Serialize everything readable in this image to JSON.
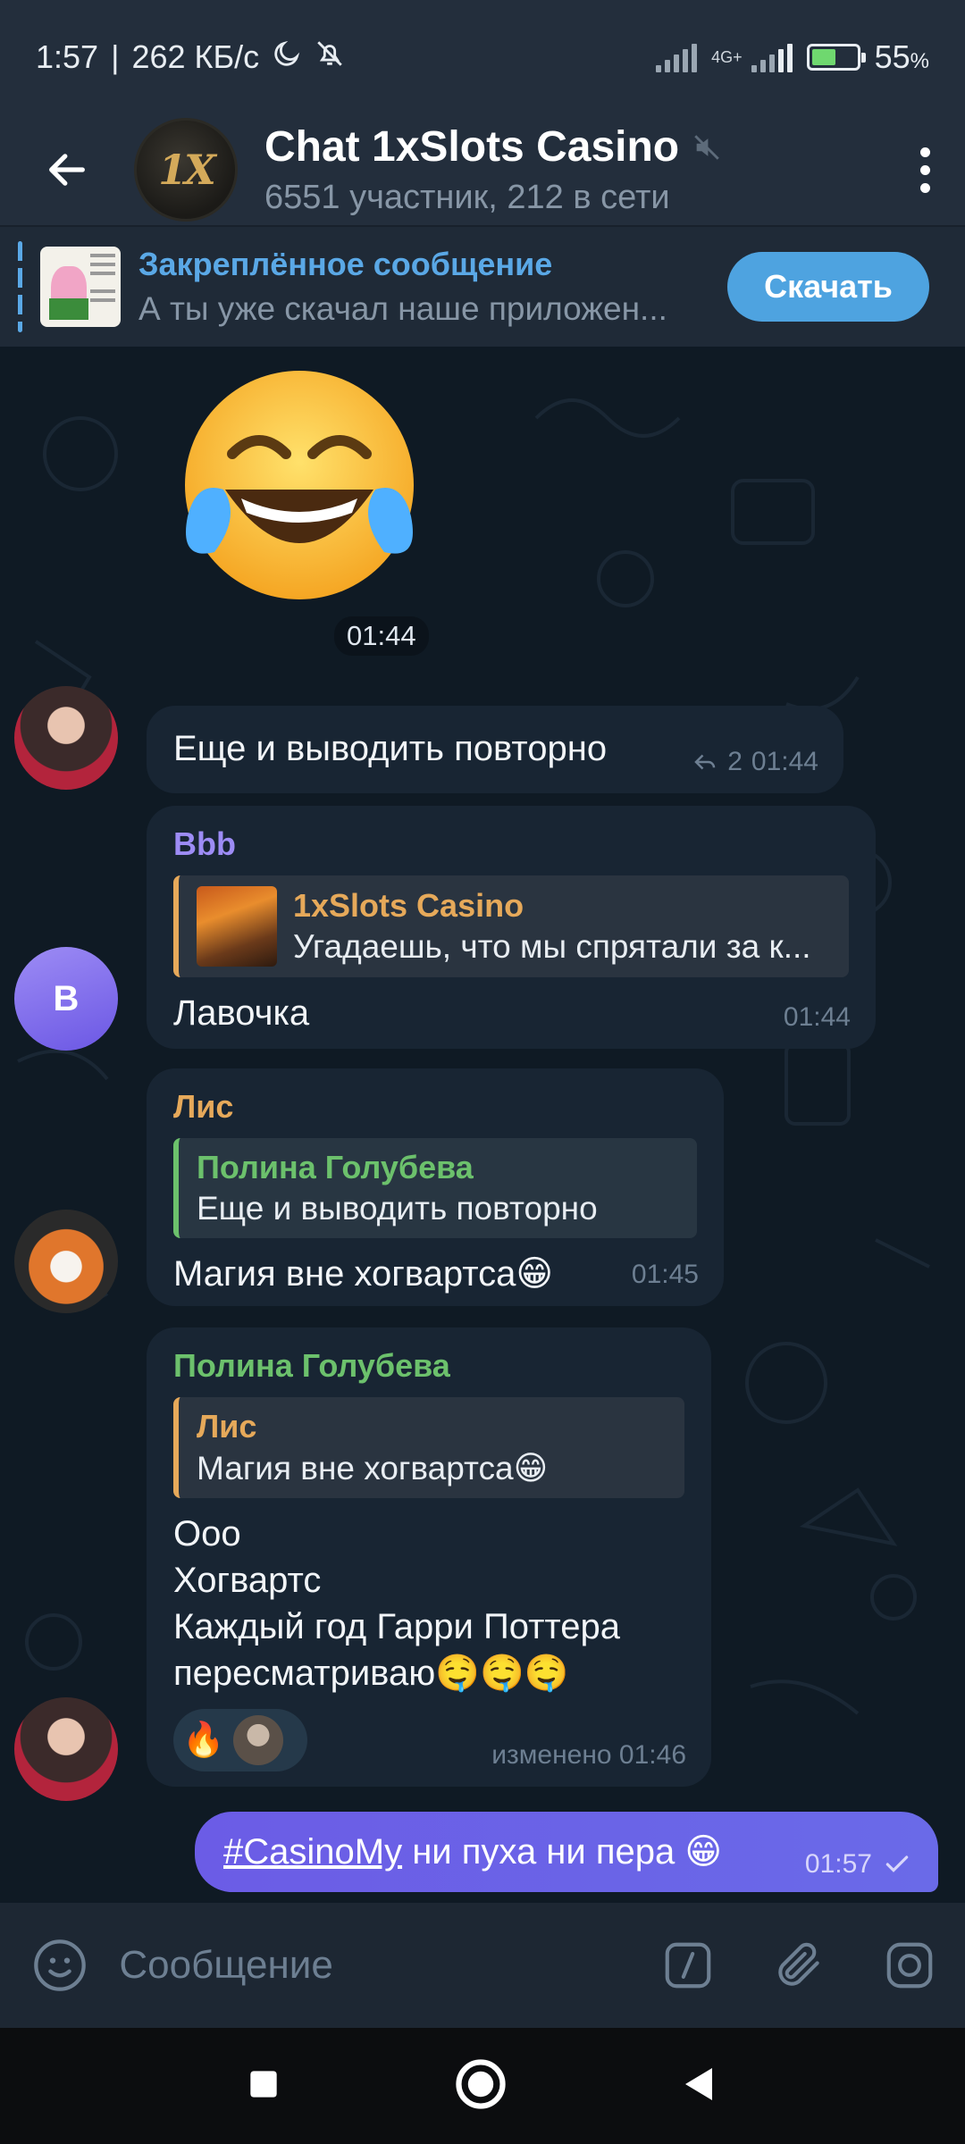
{
  "status_bar": {
    "time": "1:57",
    "speed": "262 КБ/с",
    "network": "4G+",
    "battery": "55",
    "battery_percent_sign": "%",
    "battery_level": 0.55
  },
  "header": {
    "avatar_logo": "1X",
    "title": "Chat 1xSlots Casino",
    "subtitle": "6551 участник, 212 в сети"
  },
  "pinned": {
    "title": "Закреплённое сообщение",
    "text": "А ты уже скачал наше приложен...",
    "button": "Скачать"
  },
  "messages": [
    {
      "type": "emoji",
      "emoji": "😂",
      "time": "01:44"
    },
    {
      "type": "text",
      "text": "Еще и выводить повторно",
      "replies": "2",
      "time": "01:44"
    },
    {
      "type": "reply",
      "sender": "Bbb",
      "avatar_letter": "B",
      "reply_name": "1xSlots Casino",
      "reply_text": "Угадаешь, что мы спрятали за к...",
      "text": "Лавочка",
      "time": "01:44"
    },
    {
      "type": "reply",
      "sender": "Лис",
      "reply_name": "Полина Голубева",
      "reply_text": "Еще и выводить повторно",
      "text": "Магия вне хогвартса😁",
      "time": "01:45"
    },
    {
      "type": "reply",
      "sender": "Полина Голубева",
      "reply_name": "Лис",
      "reply_text": "Магия вне хогвартса😁",
      "text_lines": [
        "Ooo",
        "Хогвартс",
        "Каждый год Гарри Поттера",
        "пересматриваю🤤🤤🤤"
      ],
      "reaction_emoji": "🔥",
      "time": "изменено 01:46"
    },
    {
      "type": "outgoing",
      "hashtag": "#CasinoMy",
      "text": " ни пуха ни пера 😁",
      "time": "01:57"
    }
  ],
  "composer": {
    "placeholder": "Сообщение"
  },
  "colors": {
    "accent": "#4ea3e0",
    "sender_bbb": "#9d8cf5",
    "sender_fox": "#e6a95a",
    "sender_polina": "#6cc16c",
    "outgoing_bubble": "#6b5ce6"
  }
}
